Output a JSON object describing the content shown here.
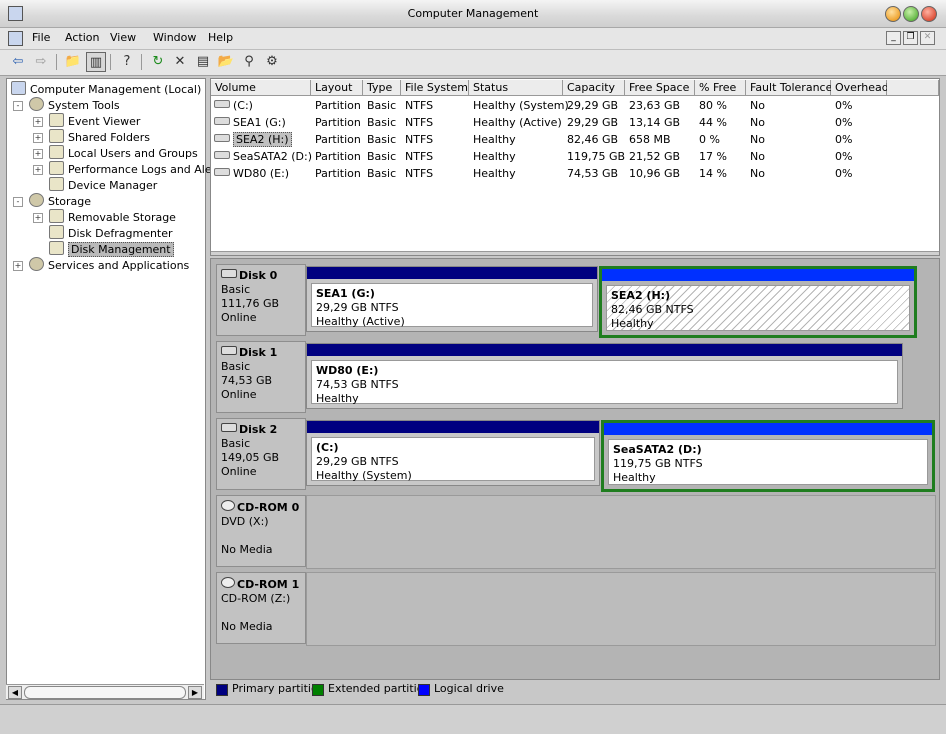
{
  "window": {
    "title": "Computer Management"
  },
  "menu": [
    "File",
    "Action",
    "View",
    "Window",
    "Help"
  ],
  "toolbar": [
    "back-icon",
    "forward-icon",
    "up-folder-icon",
    "show-hide-tree-icon",
    "help-icon",
    "refresh-icon",
    "delete-icon",
    "properties-icon",
    "open-icon",
    "search-icon",
    "settings-icon"
  ],
  "tree": [
    {
      "label": "Computer Management (Local)",
      "level": 0,
      "expander": "",
      "icon": "computer-icon"
    },
    {
      "label": "System Tools",
      "level": 1,
      "expander": "-",
      "icon": "tools-icon"
    },
    {
      "label": "Event Viewer",
      "level": 2,
      "expander": "+",
      "icon": "event-viewer-icon"
    },
    {
      "label": "Shared Folders",
      "level": 2,
      "expander": "+",
      "icon": "shared-folders-icon"
    },
    {
      "label": "Local Users and Groups",
      "level": 2,
      "expander": "+",
      "icon": "users-icon"
    },
    {
      "label": "Performance Logs and Alert",
      "level": 2,
      "expander": "+",
      "icon": "performance-icon"
    },
    {
      "label": "Device Manager",
      "level": 2,
      "expander": "",
      "icon": "device-manager-icon"
    },
    {
      "label": "Storage",
      "level": 1,
      "expander": "-",
      "icon": "storage-icon"
    },
    {
      "label": "Removable Storage",
      "level": 2,
      "expander": "+",
      "icon": "removable-storage-icon"
    },
    {
      "label": "Disk Defragmenter",
      "level": 2,
      "expander": "",
      "icon": "defragmenter-icon"
    },
    {
      "label": "Disk Management",
      "level": 2,
      "expander": "",
      "icon": "disk-management-icon",
      "selected": true
    },
    {
      "label": "Services and Applications",
      "level": 1,
      "expander": "+",
      "icon": "services-icon"
    }
  ],
  "volumes": {
    "columns": [
      "Volume",
      "Layout",
      "Type",
      "File System",
      "Status",
      "Capacity",
      "Free Space",
      "% Free",
      "Fault Tolerance",
      "Overhead"
    ],
    "rows": [
      [
        "(C:)",
        "Partition",
        "Basic",
        "NTFS",
        "Healthy (System)",
        "29,29 GB",
        "23,63 GB",
        "80 %",
        "No",
        "0%"
      ],
      [
        "SEA1 (G:)",
        "Partition",
        "Basic",
        "NTFS",
        "Healthy (Active)",
        "29,29 GB",
        "13,14 GB",
        "44 %",
        "No",
        "0%"
      ],
      [
        "SEA2 (H:)",
        "Partition",
        "Basic",
        "NTFS",
        "Healthy",
        "82,46 GB",
        "658 MB",
        "0 %",
        "No",
        "0%"
      ],
      [
        "SeaSATA2 (D:)",
        "Partition",
        "Basic",
        "NTFS",
        "Healthy",
        "119,75 GB",
        "21,52 GB",
        "17 %",
        "No",
        "0%"
      ],
      [
        "WD80 (E:)",
        "Partition",
        "Basic",
        "NTFS",
        "Healthy",
        "74,53 GB",
        "10,96 GB",
        "14 %",
        "No",
        "0%"
      ]
    ],
    "selected_row": 2
  },
  "disks": [
    {
      "name": "Disk 0",
      "type": "Basic",
      "size": "111,76 GB",
      "state": "Online",
      "partitions": [
        {
          "name": "SEA1  (G:)",
          "size": "29,29 GB NTFS",
          "status": "Healthy (Active)",
          "selected": false,
          "hatched": false
        },
        {
          "name": "SEA2  (H:)",
          "size": "82,46 GB NTFS",
          "status": "Healthy",
          "selected": true,
          "hatched": true
        }
      ]
    },
    {
      "name": "Disk 1",
      "type": "Basic",
      "size": "74,53 GB",
      "state": "Online",
      "partitions": [
        {
          "name": "WD80  (E:)",
          "size": "74,53 GB NTFS",
          "status": "Healthy",
          "selected": false,
          "hatched": false
        }
      ]
    },
    {
      "name": "Disk 2",
      "type": "Basic",
      "size": "149,05 GB",
      "state": "Online",
      "partitions": [
        {
          "name": " (C:)",
          "size": "29,29 GB NTFS",
          "status": "Healthy (System)",
          "selected": false,
          "hatched": false
        },
        {
          "name": "SeaSATA2  (D:)",
          "size": "119,75 GB NTFS",
          "status": "Healthy",
          "selected": true,
          "hatched": false
        }
      ]
    }
  ],
  "cdroms": [
    {
      "name": "CD-ROM 0",
      "drive": "DVD (X:)",
      "media": "No Media"
    },
    {
      "name": "CD-ROM 1",
      "drive": "CD-ROM (Z:)",
      "media": "No Media"
    }
  ],
  "legend": [
    {
      "label": "Primary partition",
      "color": "#000080"
    },
    {
      "label": "Extended partition",
      "color": "#008000"
    },
    {
      "label": "Logical drive",
      "color": "#0000ff"
    }
  ]
}
